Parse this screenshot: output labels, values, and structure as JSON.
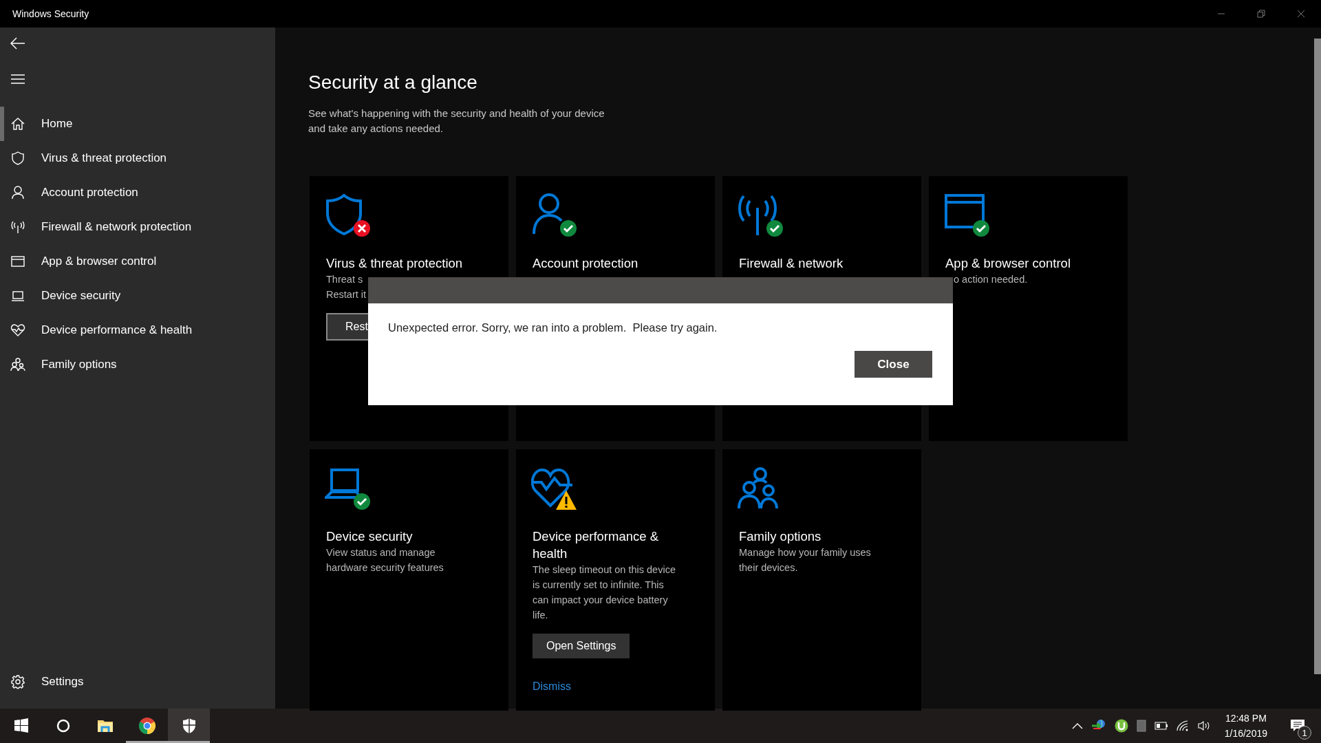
{
  "window": {
    "title": "Windows Security"
  },
  "sidebar": {
    "items": [
      {
        "label": "Home",
        "selected": true
      },
      {
        "label": "Virus & threat protection",
        "selected": false
      },
      {
        "label": "Account protection",
        "selected": false
      },
      {
        "label": "Firewall & network protection",
        "selected": false
      },
      {
        "label": "App & browser control",
        "selected": false
      },
      {
        "label": "Device security",
        "selected": false
      },
      {
        "label": "Device performance & health",
        "selected": false
      },
      {
        "label": "Family options",
        "selected": false
      }
    ],
    "settings": {
      "label": "Settings"
    }
  },
  "page": {
    "title": "Security at a glance",
    "subtitle_lines": [
      "See what's happening with the security and health of your device",
      "and take any actions needed."
    ]
  },
  "cards": [
    {
      "kind": "error",
      "title_lines": [
        "Virus & threat protection"
      ],
      "description_lines": [
        "Threat s",
        "Restart it"
      ],
      "button": "Rest"
    },
    {
      "kind": "ok",
      "title_lines": [
        "Account protection"
      ]
    },
    {
      "kind": "ok",
      "title_lines": [
        "Firewall & network"
      ]
    },
    {
      "kind": "ok",
      "title_lines": [
        "App & browser control"
      ],
      "description_lines": [
        "o action needed."
      ]
    },
    {
      "kind": "ok",
      "title_lines": [
        "Device security"
      ],
      "description_lines": [
        "View status and manage",
        "hardware security features"
      ]
    },
    {
      "kind": "warning",
      "title_lines": [
        "Device performance &",
        "health"
      ],
      "description_lines": [
        "The sleep timeout on this device",
        "is currently set to infinite. This",
        "can impact your device battery",
        "life."
      ],
      "button": "Open Settings",
      "link": "Dismiss"
    },
    {
      "kind": "plain",
      "title_lines": [
        "Family options"
      ],
      "description_lines": [
        "Manage how your family uses",
        "their devices."
      ]
    }
  ],
  "dialog": {
    "message": "Unexpected error. Sorry, we ran into a problem.  Please try again.",
    "button": "Close"
  },
  "taskbar": {
    "apps": [
      {
        "running": false,
        "selected": false
      },
      {
        "running": false,
        "selected": false
      },
      {
        "running": false,
        "selected": false
      },
      {
        "running": true,
        "selected": false
      },
      {
        "running": true,
        "selected": true
      }
    ],
    "time": "12:48 PM",
    "date": "1/16/2019",
    "notification_count": "1"
  }
}
